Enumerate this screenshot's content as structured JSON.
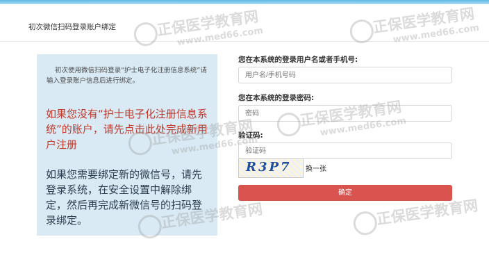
{
  "header": {
    "title": "初次微信扫码登录账户绑定"
  },
  "panel": {
    "intro": "初次使用微信扫码登录“护士电子化注册信息系统”请输入登录账户信息后进行绑定。",
    "red_note": "如果您没有“护士电子化注册信息系统”的账户，请先点击此处完成新用户注册",
    "blue_note": "如果您需要绑定新的微信号，请先登录系统，在安全设置中解除绑定，然后再完成新微信号的扫码登录绑定。"
  },
  "form": {
    "username_label": "您在本系统的登录用户名或者手机号:",
    "username_placeholder": "用户名/手机号码",
    "password_label": "您在本系统的登录密码:",
    "password_placeholder": "密码",
    "captcha_label": "验证码:",
    "captcha_placeholder": "验证码",
    "captcha_text": "R3P7",
    "refresh_label": "换一张",
    "submit_label": "确定"
  },
  "watermark": {
    "brand": "正保医学教育网",
    "url": "www.med66.com"
  },
  "colors": {
    "submit": "#d9534f",
    "red_note": "#c0392b",
    "panel_bg": "#d9eaf4"
  }
}
